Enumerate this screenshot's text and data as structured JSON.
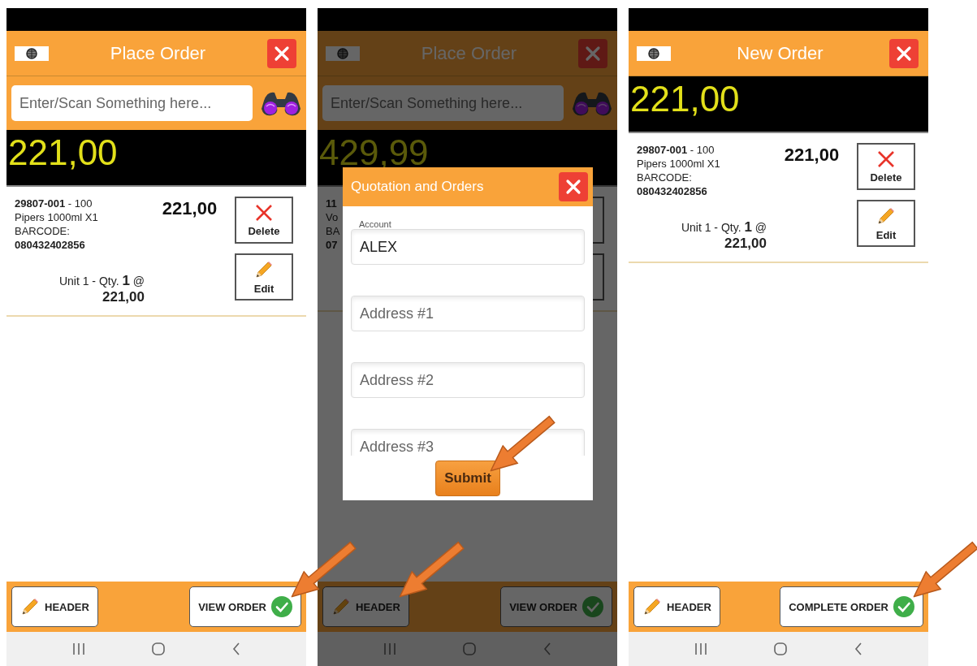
{
  "screens": [
    {
      "title": "Place Order",
      "search": {
        "placeholder": "Enter/Scan Something here..."
      },
      "total": "221,00",
      "dimmed": false,
      "items": [
        {
          "lines": [
            "**29807-001** - 100",
            "Pipers 1000ml X1",
            "BARCODE:",
            "**080432402856**"
          ],
          "price": "221,00",
          "qty_line": "Unit 1 - Qty. **1** @",
          "qty_price": "221,00",
          "buttons": [
            {
              "kind": "delete",
              "label": "Delete"
            },
            {
              "kind": "edit",
              "label": "Edit"
            }
          ]
        }
      ],
      "footer": [
        {
          "kind": "header",
          "label": "HEADER",
          "pointed": false
        },
        {
          "kind": "confirm",
          "label": "VIEW ORDER",
          "pointed": true
        }
      ]
    },
    {
      "title": "Place Order",
      "search": {
        "placeholder": "Enter/Scan Something here..."
      },
      "total": "429,99",
      "dimmed": true,
      "items": [
        {
          "lines": [
            "**11**",
            "Vo",
            "BA",
            "**07**"
          ],
          "buttons": [
            {
              "kind": "delete"
            },
            {
              "kind": "edit"
            }
          ]
        }
      ],
      "footer": [
        {
          "kind": "header",
          "label": "HEADER",
          "pointed": true
        },
        {
          "kind": "confirm",
          "label": "VIEW ORDER",
          "pointed": false
        }
      ],
      "dialog": {
        "title": "Quotation and Orders",
        "fields": [
          {
            "label": "Account",
            "value": "ALEX"
          },
          {
            "placeholder": "Address #1"
          },
          {
            "placeholder": "Address #2"
          },
          {
            "placeholder": "Address #3"
          }
        ],
        "submit": {
          "label": "Submit",
          "pointed": true
        }
      }
    },
    {
      "title": "New Order",
      "total": "221,00",
      "dimmed": false,
      "items": [
        {
          "lines": [
            "**29807-001** - 100",
            "Pipers 1000ml X1",
            "BARCODE:",
            "**080432402856**"
          ],
          "price": "221,00",
          "qty_line": "Unit 1 - Qty. **1** @",
          "qty_price": "221,00",
          "buttons": [
            {
              "kind": "delete",
              "label": "Delete"
            },
            {
              "kind": "edit",
              "label": "Edit"
            }
          ]
        }
      ],
      "footer": [
        {
          "kind": "header",
          "label": "HEADER",
          "pointed": false
        },
        {
          "kind": "confirm",
          "label": "COMPLETE ORDER",
          "pointed": true
        }
      ]
    }
  ]
}
